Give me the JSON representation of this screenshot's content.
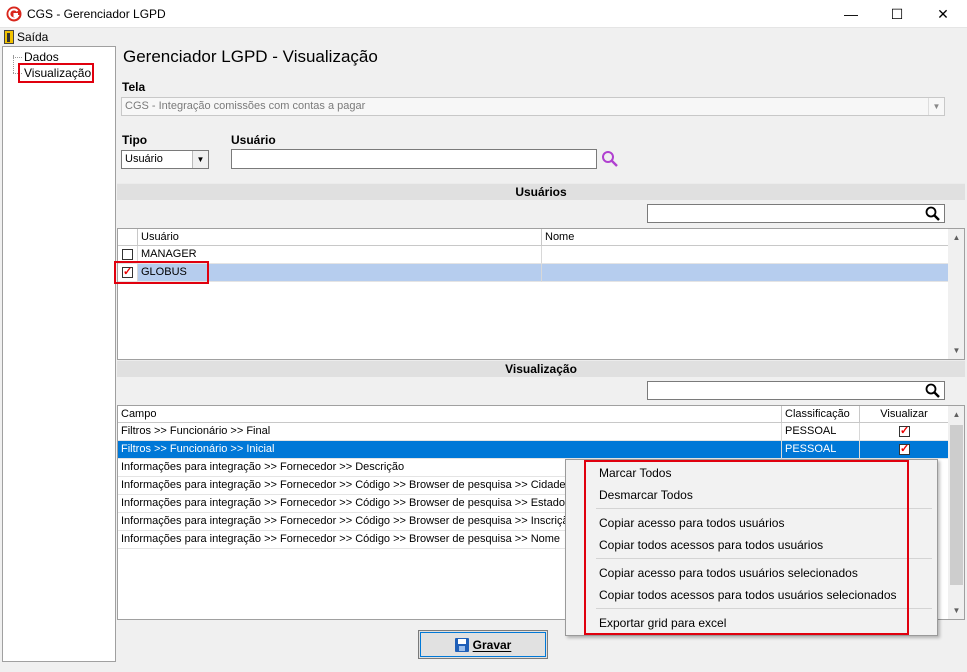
{
  "window": {
    "title": "CGS - Gerenciador LGPD",
    "minimize": "—",
    "maximize": "☐",
    "close": "✕"
  },
  "menu": {
    "exit_label": "Saída"
  },
  "tree": {
    "items": [
      "Dados",
      "Visualização"
    ]
  },
  "page_title": "Gerenciador LGPD - Visualização",
  "tela": {
    "label": "Tela",
    "value": "CGS - Integração comissões com contas a pagar"
  },
  "tipo": {
    "label": "Tipo",
    "value": "Usuário"
  },
  "usuario": {
    "label": "Usuário",
    "value": ""
  },
  "users_section": {
    "title": "Usuários",
    "filter_value": "",
    "columns": [
      "Usuário",
      "Nome"
    ],
    "rows": [
      {
        "user": "MANAGER",
        "name": "",
        "checked": false
      },
      {
        "user": "GLOBUS",
        "name": "",
        "checked": true
      }
    ]
  },
  "view_section": {
    "title": "Visualização",
    "filter_value": "",
    "columns": [
      "Campo",
      "Classificação",
      "Visualizar"
    ],
    "rows": [
      {
        "campo": "Filtros >> Funcionário >> Final",
        "classificacao": "PESSOAL",
        "visualizar": true
      },
      {
        "campo": "Filtros >> Funcionário >> Inicial",
        "classificacao": "PESSOAL",
        "visualizar": true
      },
      {
        "campo": "Informações para integração >> Fornecedor >> Descrição",
        "classificacao": "",
        "visualizar": null
      },
      {
        "campo": "Informações para integração >> Fornecedor >> Código >> Browser de pesquisa >> Cidade",
        "classificacao": "",
        "visualizar": null
      },
      {
        "campo": "Informações para integração >> Fornecedor >> Código >> Browser de pesquisa >> Estado",
        "classificacao": "",
        "visualizar": null
      },
      {
        "campo": "Informações para integração >> Fornecedor >> Código >> Browser de pesquisa >> Inscrição",
        "classificacao": "",
        "visualizar": null
      },
      {
        "campo": "Informações para integração >> Fornecedor >> Código >> Browser de pesquisa >> Nome",
        "classificacao": "",
        "visualizar": null
      }
    ]
  },
  "context_menu": {
    "items": [
      "Marcar Todos",
      "Desmarcar Todos",
      "Copiar acesso para todos usuários",
      "Copiar todos acessos para todos usuários",
      "Copiar acesso para todos usuários selecionados",
      "Copiar todos acessos para todos usuários selecionados",
      "Exportar grid para excel"
    ]
  },
  "gravar_button": {
    "label": "Gravar"
  },
  "colors": {
    "highlight_red": "#e0000e",
    "selection_blue": "#0078d7",
    "selection_light": "#b6cdee",
    "search_icon": "#b040d0"
  }
}
